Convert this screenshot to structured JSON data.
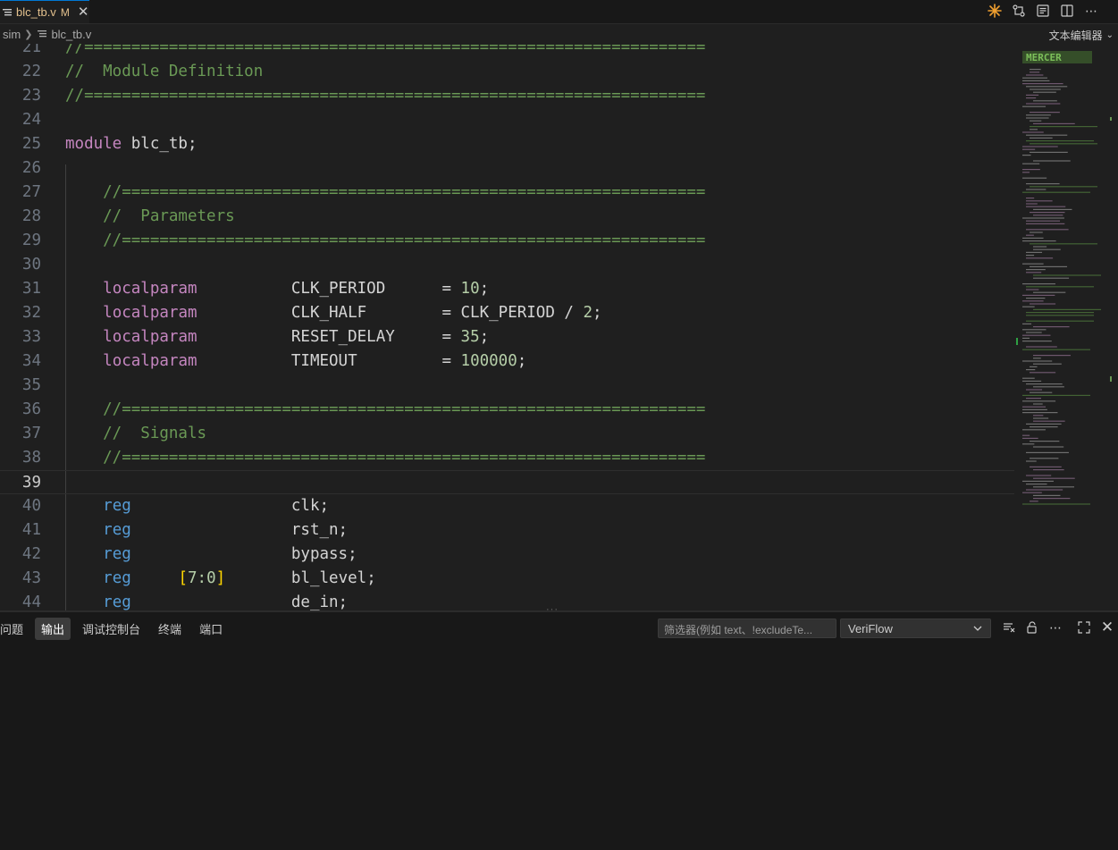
{
  "tab": {
    "filename": "blc_tb.v",
    "modified_marker": "M"
  },
  "breadcrumb": {
    "folder": "sim",
    "file": "blc_tb.v"
  },
  "language_mode": "文本编辑器",
  "editor": {
    "lines": [
      {
        "n": "21",
        "tokens": [
          [
            "c-comment",
            "//=================================================================="
          ]
        ]
      },
      {
        "n": "22",
        "tokens": [
          [
            "c-comment",
            "//  Module Definition"
          ]
        ]
      },
      {
        "n": "23",
        "tokens": [
          [
            "c-comment",
            "//=================================================================="
          ]
        ]
      },
      {
        "n": "24",
        "tokens": []
      },
      {
        "n": "25",
        "tokens": [
          [
            "c-kw-purple",
            "module"
          ],
          [
            "c-ident",
            " blc_tb;"
          ]
        ]
      },
      {
        "n": "26",
        "tokens": []
      },
      {
        "n": "27",
        "tokens": [
          [
            "c-comment",
            "    //=============================================================="
          ]
        ]
      },
      {
        "n": "28",
        "tokens": [
          [
            "c-comment",
            "    //  Parameters"
          ]
        ]
      },
      {
        "n": "29",
        "tokens": [
          [
            "c-comment",
            "    //=============================================================="
          ]
        ]
      },
      {
        "n": "30",
        "tokens": []
      },
      {
        "n": "31",
        "tokens": [
          [
            "c-ident",
            "    "
          ],
          [
            "c-kw-purple",
            "localparam"
          ],
          [
            "c-ident",
            "          CLK_PERIOD      = "
          ],
          [
            "c-num",
            "10"
          ],
          [
            "c-ident",
            ";"
          ]
        ]
      },
      {
        "n": "32",
        "tokens": [
          [
            "c-ident",
            "    "
          ],
          [
            "c-kw-purple",
            "localparam"
          ],
          [
            "c-ident",
            "          CLK_HALF        = CLK_PERIOD / "
          ],
          [
            "c-num",
            "2"
          ],
          [
            "c-ident",
            ";"
          ]
        ]
      },
      {
        "n": "33",
        "tokens": [
          [
            "c-ident",
            "    "
          ],
          [
            "c-kw-purple",
            "localparam"
          ],
          [
            "c-ident",
            "          RESET_DELAY     = "
          ],
          [
            "c-num",
            "35"
          ],
          [
            "c-ident",
            ";"
          ]
        ]
      },
      {
        "n": "34",
        "tokens": [
          [
            "c-ident",
            "    "
          ],
          [
            "c-kw-purple",
            "localparam"
          ],
          [
            "c-ident",
            "          TIMEOUT         = "
          ],
          [
            "c-num",
            "100000"
          ],
          [
            "c-ident",
            ";"
          ]
        ]
      },
      {
        "n": "35",
        "tokens": []
      },
      {
        "n": "36",
        "tokens": [
          [
            "c-comment",
            "    //=============================================================="
          ]
        ]
      },
      {
        "n": "37",
        "tokens": [
          [
            "c-comment",
            "    //  Signals"
          ]
        ]
      },
      {
        "n": "38",
        "tokens": [
          [
            "c-comment",
            "    //=============================================================="
          ]
        ]
      },
      {
        "n": "39",
        "tokens": [],
        "current": true
      },
      {
        "n": "40",
        "tokens": [
          [
            "c-ident",
            "    "
          ],
          [
            "c-kw-blue",
            "reg"
          ],
          [
            "c-ident",
            "                 clk;"
          ]
        ]
      },
      {
        "n": "41",
        "tokens": [
          [
            "c-ident",
            "    "
          ],
          [
            "c-kw-blue",
            "reg"
          ],
          [
            "c-ident",
            "                 rst_n;"
          ]
        ]
      },
      {
        "n": "42",
        "tokens": [
          [
            "c-ident",
            "    "
          ],
          [
            "c-kw-blue",
            "reg"
          ],
          [
            "c-ident",
            "                 bypass;"
          ]
        ]
      },
      {
        "n": "43",
        "tokens": [
          [
            "c-ident",
            "    "
          ],
          [
            "c-kw-blue",
            "reg"
          ],
          [
            "c-ident",
            "     "
          ],
          [
            "c-bracket",
            "["
          ],
          [
            "c-range",
            "7:0"
          ],
          [
            "c-bracket",
            "]"
          ],
          [
            "c-ident",
            "       bl_level;"
          ]
        ]
      },
      {
        "n": "44",
        "tokens": [
          [
            "c-ident",
            "    "
          ],
          [
            "c-kw-blue",
            "reg"
          ],
          [
            "c-ident",
            "                 de_in;"
          ]
        ]
      }
    ]
  },
  "panel": {
    "tabs": [
      "问题",
      "输出",
      "调试控制台",
      "终端",
      "端口"
    ],
    "active_tab": "输出",
    "filter_placeholder": "筛选器(例如 text、!excludeTe...",
    "channel_selected": "VeriFlow"
  },
  "colors": {
    "accent": "#0078d4",
    "modified": "#e2c08d",
    "comment": "#6a9955",
    "keyword_purple": "#c586c0",
    "keyword_blue": "#569cd6",
    "number": "#b5cea8",
    "bracket": "#ffd700"
  },
  "icons": {
    "tab": "file-text-icon",
    "close": "close-icon",
    "top_actions": [
      "sparkle-icon",
      "compare-changes-icon",
      "open-preview-icon",
      "split-editor-icon",
      "more-icon"
    ],
    "panel_actions": [
      "clear-output-icon",
      "lock-scroll-icon",
      "more-icon",
      "maximize-icon",
      "close-icon"
    ]
  }
}
